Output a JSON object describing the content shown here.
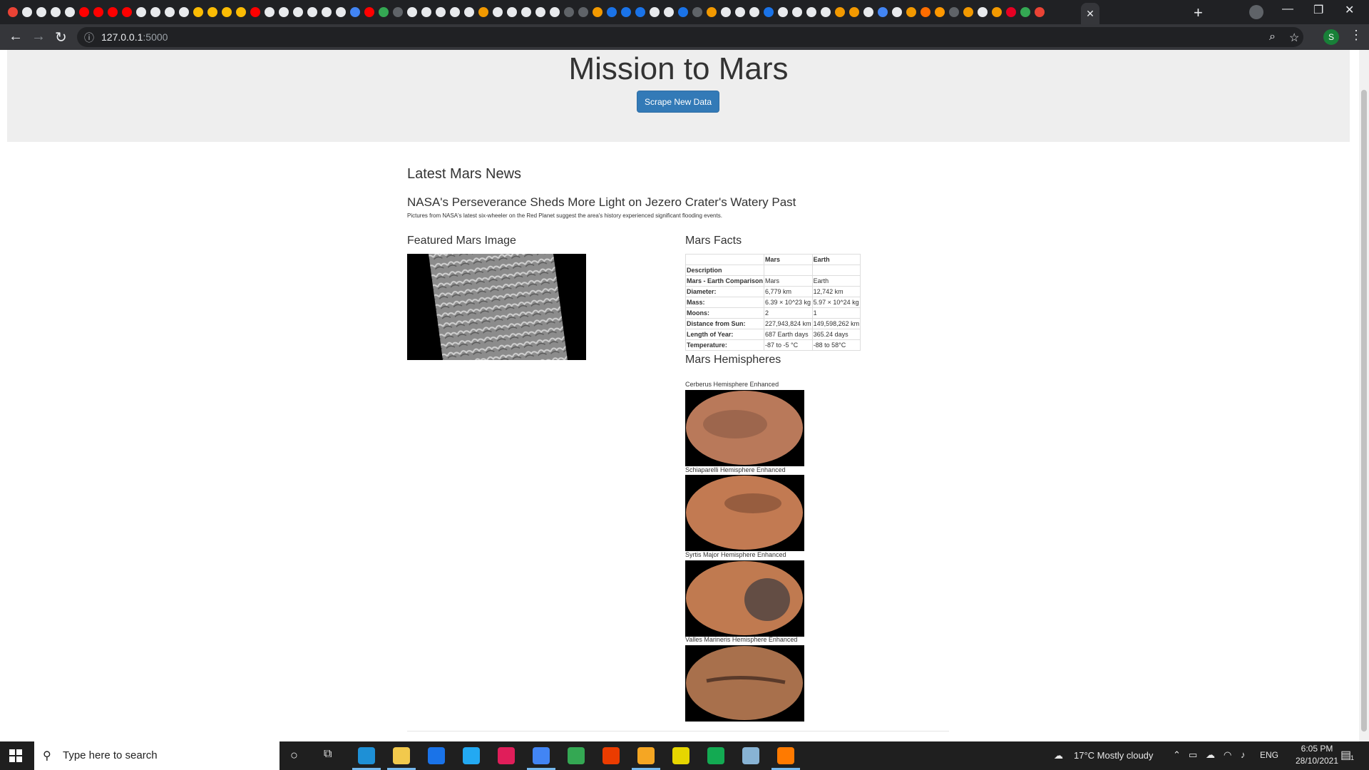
{
  "browser": {
    "url_host": "127.0.0.1",
    "url_port": ":5000",
    "active_tab_close": "✕",
    "new_tab": "+",
    "profile_initial": "S"
  },
  "page": {
    "title": "Mission to Mars",
    "scrape_button": "Scrape New Data",
    "news_heading": "Latest Mars News",
    "news_title": "NASA's Perseverance Sheds More Light on Jezero Crater's Watery Past",
    "news_paragraph": "Pictures from NASA's latest six-wheeler on the Red Planet suggest the area's history experienced significant flooding events.",
    "featured_heading": "Featured Mars Image",
    "facts_heading": "Mars Facts",
    "hemispheres_heading": "Mars Hemispheres"
  },
  "facts_table": {
    "header": [
      "",
      "Mars",
      "Earth"
    ],
    "rows": [
      [
        "Description",
        "",
        ""
      ],
      [
        "Mars - Earth Comparison",
        "Mars",
        "Earth"
      ],
      [
        "Diameter:",
        "6,779 km",
        "12,742 km"
      ],
      [
        "Mass:",
        "6.39 × 10^23 kg",
        "5.97 × 10^24 kg"
      ],
      [
        "Moons:",
        "2",
        "1"
      ],
      [
        "Distance from Sun:",
        "227,943,824 km",
        "149,598,262 km"
      ],
      [
        "Length of Year:",
        "687 Earth days",
        "365.24 days"
      ],
      [
        "Temperature:",
        "-87 to -5 °C",
        "-88 to 58°C"
      ]
    ]
  },
  "hemispheres": [
    {
      "title": "Cerberus Hemisphere Enhanced"
    },
    {
      "title": "Schiaparelli Hemisphere Enhanced"
    },
    {
      "title": "Syrtis Major Hemisphere Enhanced"
    },
    {
      "title": "Valles Marineris Hemisphere Enhanced"
    }
  ],
  "taskbar": {
    "search_placeholder": "Type here to search",
    "weather": "17°C  Mostly cloudy",
    "language": "ENG",
    "time": "6:05 PM",
    "date": "28/10/2021",
    "notification_count": "1"
  },
  "colors": {
    "jumbotron_bg": "#eeeeee",
    "button_primary": "#337ab7",
    "chrome_dark": "#202124"
  }
}
